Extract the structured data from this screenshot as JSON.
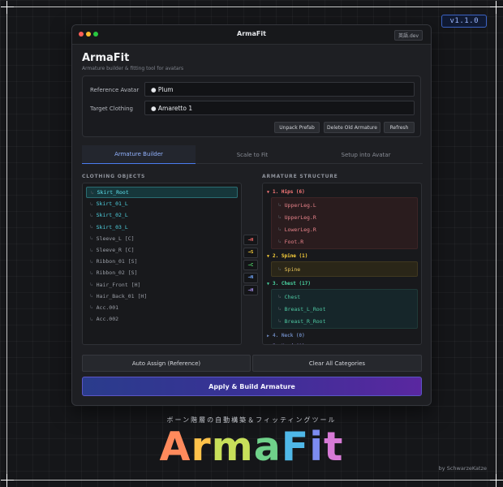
{
  "version": "v1.1.0",
  "window": {
    "title": "ArmaFit",
    "lang_button": "英語.dev",
    "dot_colors": [
      "#ff5f57",
      "#febc2e",
      "#28c840"
    ]
  },
  "app": {
    "title": "ArmaFit",
    "subtitle": "Armature builder & fitting tool for avatars"
  },
  "settings": {
    "reference_label": "Reference Avatar",
    "reference_value": "● Plum",
    "target_label": "Target Clothing",
    "target_value": "● Amaretto 1",
    "unpack_button": "Unpack Prefab",
    "delete_button": "Delete Old Armature",
    "refresh_button": "Refresh"
  },
  "tabs": [
    "Armature Builder",
    "Scale to Fit",
    "Setup into Avatar"
  ],
  "active_tab": 0,
  "clothing": {
    "heading": "CLOTHING OBJECTS",
    "items": [
      {
        "label": "Skirt_Root",
        "state": "selected"
      },
      {
        "label": "Skirt_01_L",
        "state": "assigned"
      },
      {
        "label": "Skirt_02_L",
        "state": "assigned"
      },
      {
        "label": "Skirt_03_L",
        "state": "assigned"
      },
      {
        "label": "Sleeve_L [C]",
        "state": "normal"
      },
      {
        "label": "Sleeve_R [C]",
        "state": "normal"
      },
      {
        "label": "Ribbon_01 [S]",
        "state": "normal"
      },
      {
        "label": "Ribbon_02 [S]",
        "state": "normal"
      },
      {
        "label": "Hair_Front [H]",
        "state": "normal"
      },
      {
        "label": "Hair_Back_01 [H]",
        "state": "normal"
      },
      {
        "label": "Acc.001",
        "state": "normal"
      },
      {
        "label": "Acc.002",
        "state": "normal"
      }
    ]
  },
  "assign_buttons": [
    {
      "label": "→H",
      "color": "#ff6b6b"
    },
    {
      "label": "→S",
      "color": "#ffd43b"
    },
    {
      "label": "→C",
      "color": "#51cf66"
    },
    {
      "label": "→N",
      "color": "#74a9ff"
    },
    {
      "label": "→H",
      "color": "#b197fc"
    }
  ],
  "armature": {
    "heading": "ARMATURE STRUCTURE",
    "groups": [
      {
        "header": "1. Hips (6)",
        "expanded": true,
        "color": "#ff7b7b",
        "bg": "#2a1c1e",
        "border": "#3d2426",
        "bones": [
          "UpperLeg.L",
          "UpperLeg.R",
          "LowerLeg.R",
          "Foot.R"
        ],
        "bone_color": "#e8838a"
      },
      {
        "header": "2. Spine (1)",
        "expanded": true,
        "color": "#ffd43b",
        "bg": "#2a2618",
        "border": "#403820",
        "bones": [
          "Spine"
        ],
        "bone_color": "#e8c45a"
      },
      {
        "header": "3. Chest (17)",
        "expanded": true,
        "color": "#4ad6a2",
        "bg": "#16262a",
        "border": "#1f3a38",
        "bones": [
          "Chest",
          "Breast_L_Root",
          "Breast_R_Root"
        ],
        "bone_color": "#4fc9a3"
      },
      {
        "header": "4. Neck (0)",
        "expanded": false,
        "color": "#6a84b8",
        "bg": "",
        "border": "",
        "bones": [],
        "bone_color": ""
      },
      {
        "header": "5. Head (0)",
        "expanded": false,
        "color": "#7a73b0",
        "bg": "",
        "border": "",
        "bones": [],
        "bone_color": ""
      }
    ]
  },
  "actions": {
    "auto_assign": "Auto Assign (Reference)",
    "clear_all": "Clear All Categories",
    "apply": "Apply & Build Armature"
  },
  "footer": {
    "jp_tagline": "ボーン階層の自動構築＆フィッティングツール",
    "logo_letters": [
      {
        "ch": "A",
        "color": "#ff8a5c"
      },
      {
        "ch": "r",
        "color": "#ffc24a"
      },
      {
        "ch": "m",
        "color": "#c8e05a"
      },
      {
        "ch": "a",
        "color": "#6fd18a"
      },
      {
        "ch": "F",
        "color": "#4fb8e8"
      },
      {
        "ch": "i",
        "color": "#7c8cf0"
      },
      {
        "ch": "t",
        "color": "#d77ad6"
      }
    ],
    "credit": "by SchwarzeKatze"
  }
}
